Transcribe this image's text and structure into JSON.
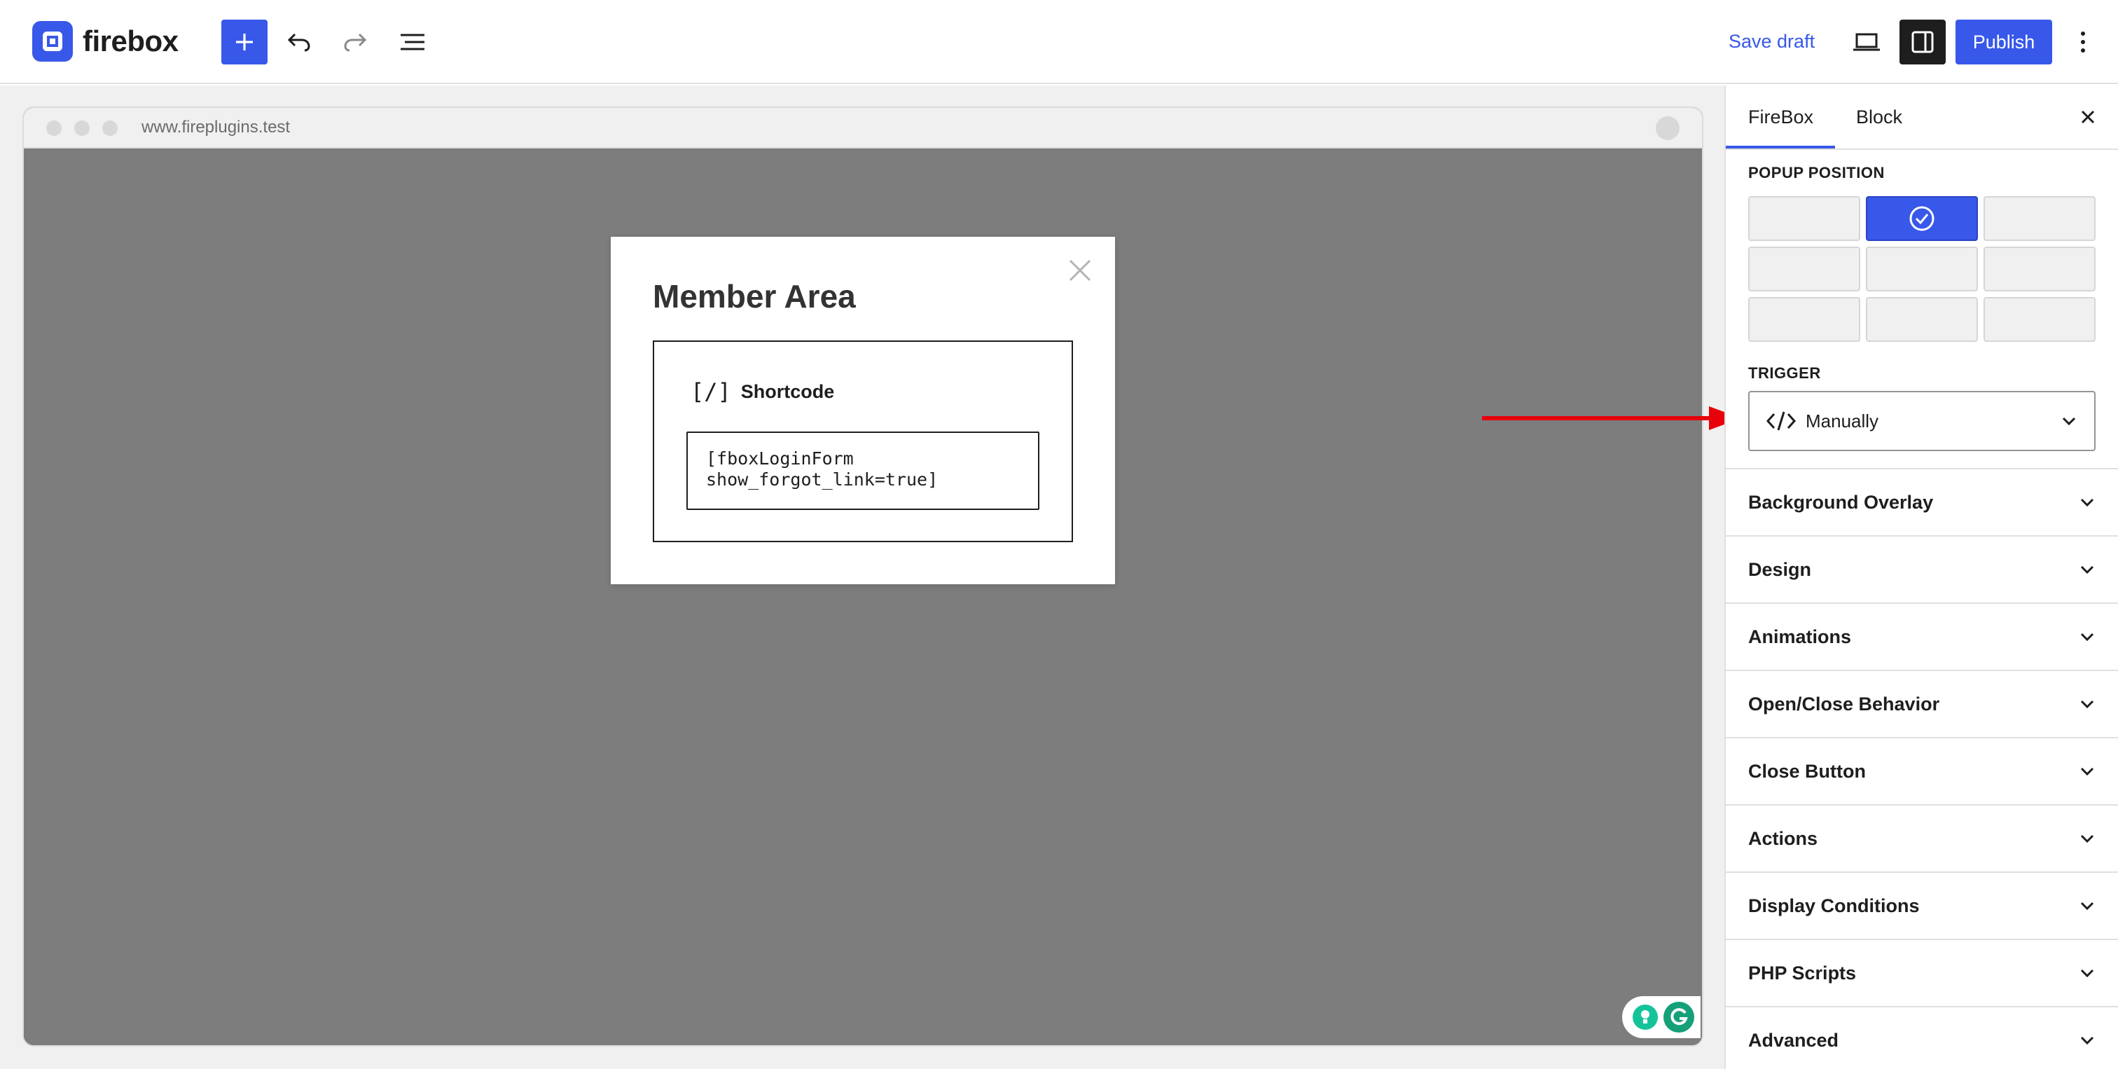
{
  "app": {
    "logo_text": "firebox"
  },
  "toolbar": {
    "add_icon": "plus-icon",
    "undo_icon": "undo-icon",
    "redo_icon": "redo-icon",
    "list_view_icon": "list-view-icon",
    "save_draft_label": "Save draft",
    "view_icon": "laptop-icon",
    "settings_icon": "sidebar-panel-icon",
    "publish_label": "Publish",
    "more_icon": "more-vertical-icon"
  },
  "browser": {
    "url": "www.fireplugins.test"
  },
  "popup": {
    "title": "Member Area",
    "shortcode_icon_text": "[/]",
    "shortcode_label": "Shortcode",
    "shortcode_value": "[fboxLoginForm\nshow_forgot_link=true]"
  },
  "sidebar": {
    "tabs": [
      {
        "label": "FireBox",
        "active": true
      },
      {
        "label": "Block",
        "active": false
      }
    ],
    "popup_position_label": "POPUP POSITION",
    "popup_position_selected": "top-center",
    "trigger_label": "TRIGGER",
    "trigger_value": "Manually",
    "panels": [
      {
        "label": "Background Overlay"
      },
      {
        "label": "Design"
      },
      {
        "label": "Animations"
      },
      {
        "label": "Open/Close Behavior"
      },
      {
        "label": "Close Button"
      },
      {
        "label": "Actions"
      },
      {
        "label": "Display Conditions"
      },
      {
        "label": "PHP Scripts"
      },
      {
        "label": "Advanced"
      }
    ]
  },
  "colors": {
    "accent": "#3858e9",
    "annotation_arrow": "#e8000b"
  }
}
